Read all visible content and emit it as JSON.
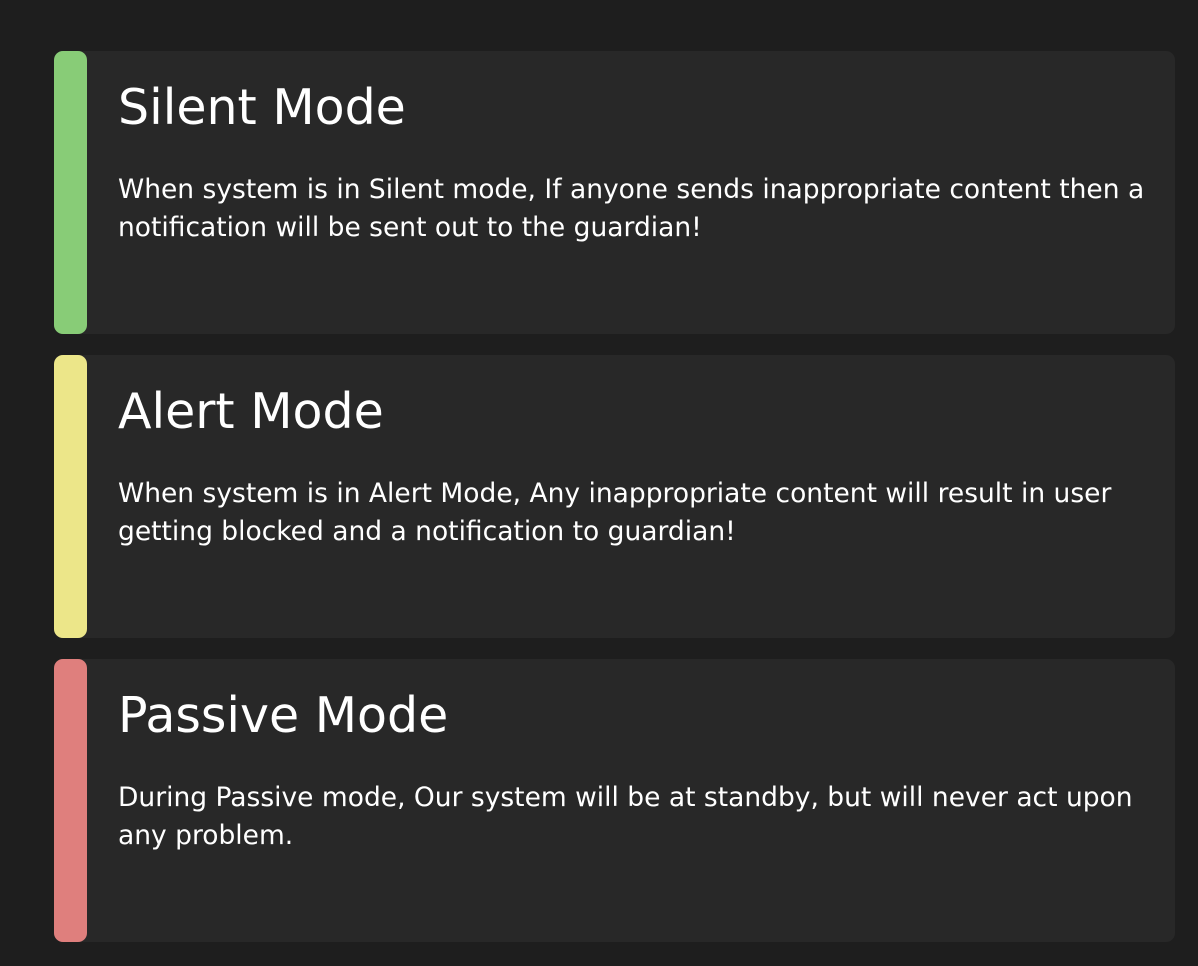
{
  "modes": [
    {
      "title": "Silent Mode",
      "description": "When system is in Silent mode, If anyone sends inappropriate content then a notification will be sent out to the guardian!",
      "accent_color": "#88cc77"
    },
    {
      "title": "Alert Mode",
      "description": "When system is in Alert Mode, Any inappropriate content will result in user getting blocked and a notification to guardian!",
      "accent_color": "#ece689"
    },
    {
      "title": "Passive Mode",
      "description": "During Passive mode, Our system will be at standby, but will never act upon any problem.",
      "accent_color": "#df7f7d"
    }
  ]
}
